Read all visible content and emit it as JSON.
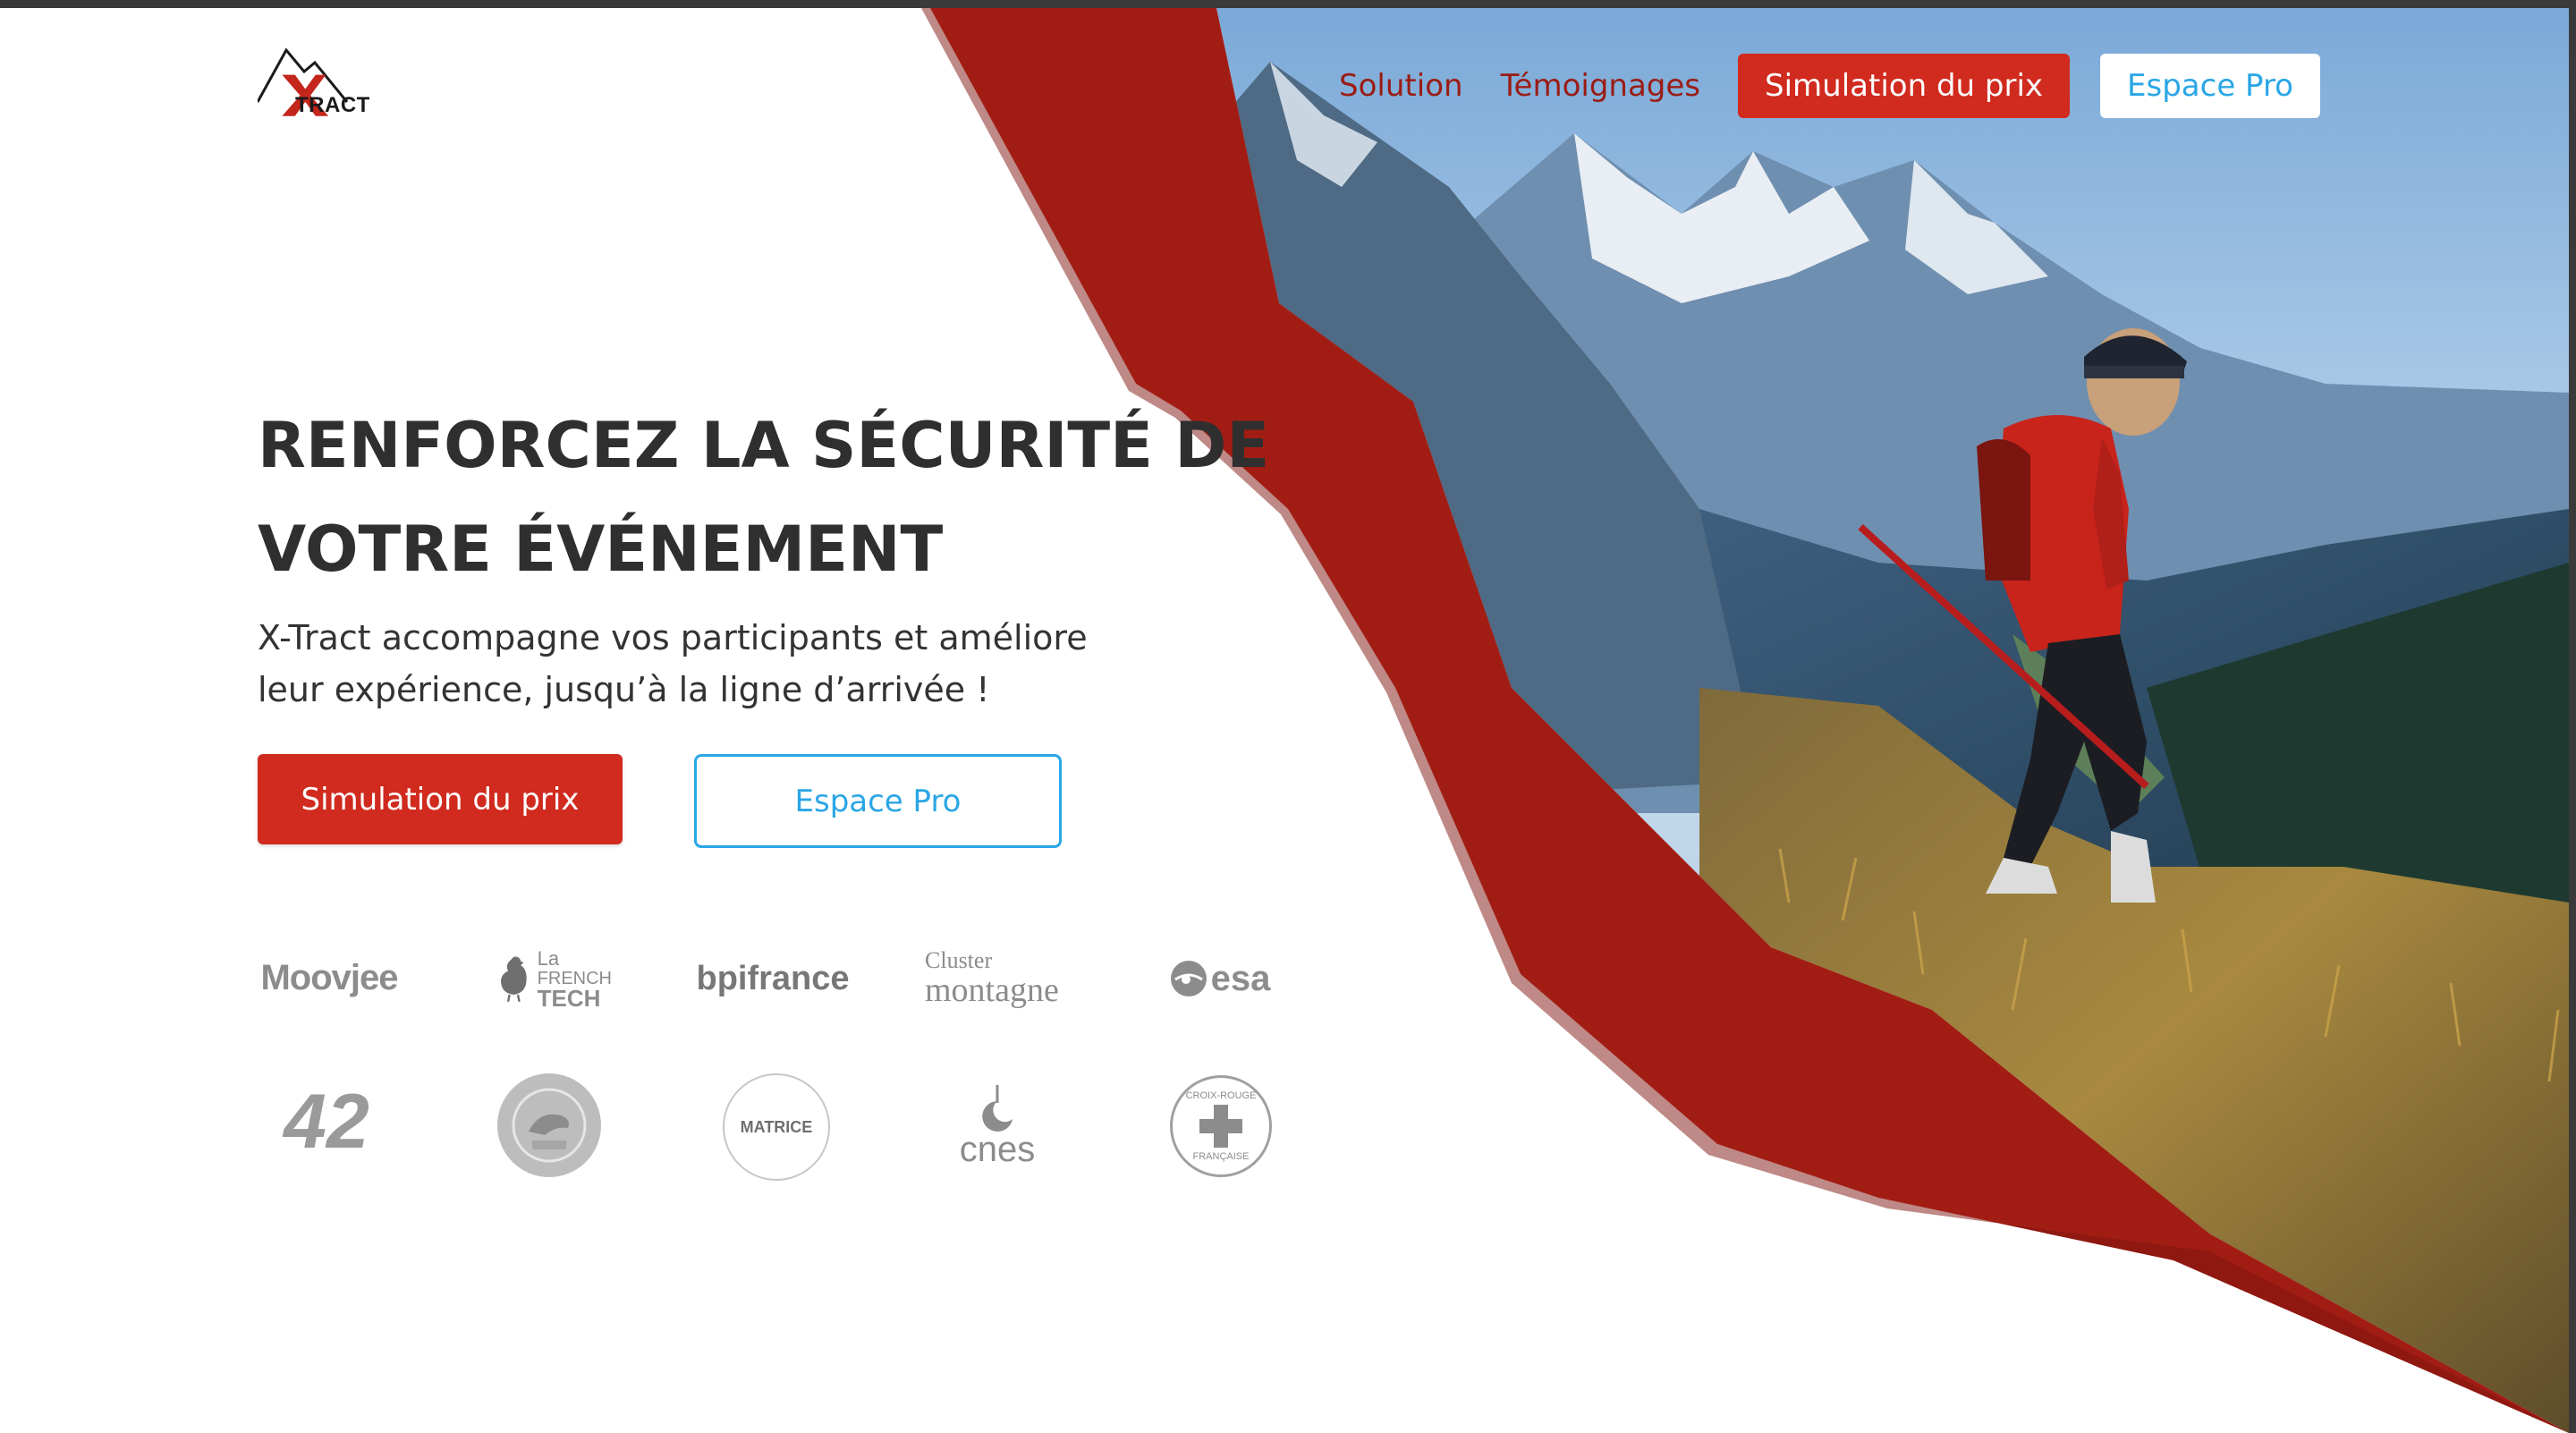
{
  "brand": {
    "logo_text": "TRACT",
    "colors": {
      "primary_red": "#d02b1e",
      "dark_red": "#9a1c14",
      "accent_blue": "#2aa6e6",
      "heading": "#2f2f2f"
    }
  },
  "nav": {
    "links": [
      "Solution",
      "Témoignages"
    ],
    "primary_button": "Simulation du prix",
    "secondary_button": "Espace Pro"
  },
  "hero": {
    "headline_line1": "RENFORCEZ LA SÉCURITÉ DE",
    "headline_line2": "VOTRE ÉVÉNEMENT",
    "subtitle_line1": "X-Tract accompagne vos participants et améliore",
    "subtitle_line2": "leur expérience, jusqu’à la ligne d’arrivée !",
    "cta_primary": "Simulation du prix",
    "cta_secondary": "Espace Pro"
  },
  "partners": {
    "moovjee": "Moovjee",
    "frenchtech_1": "La",
    "frenchtech_2": "FRENCH",
    "frenchtech_3": "TECH",
    "bpi": "bpifrance",
    "cluster_1": "Cluster",
    "cluster_2": "montagne",
    "esa": "esa",
    "school42": "42",
    "matrice": "MATRICE",
    "cnes": "cnes",
    "croixrouge_top": "CROIX-ROUGE",
    "croixrouge_bottom": "FRANÇAISE"
  }
}
